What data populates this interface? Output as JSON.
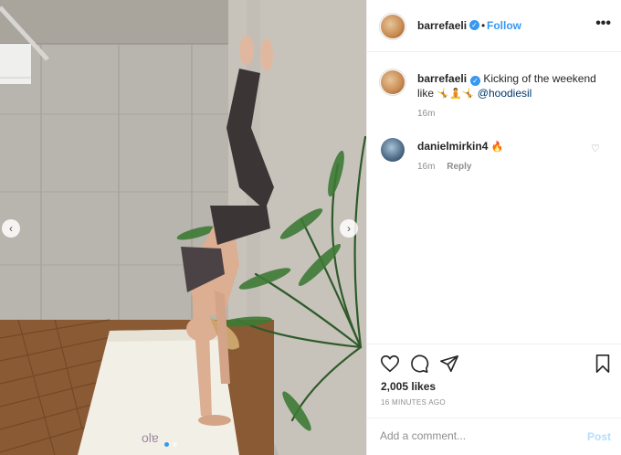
{
  "post": {
    "username": "barrefaeli",
    "verified_icon": "verified-badge-icon",
    "separator": "•",
    "follow_label": "Follow",
    "more_label": "•••"
  },
  "caption": {
    "username": "barrefaeli",
    "text_part1": "Kicking of the weekend",
    "text_part2": "like",
    "emojis": "🤸🧘🤸",
    "mention": "@hoodiesil",
    "time": "16m"
  },
  "comments": [
    {
      "username": "danielmirkin4",
      "text": "🔥",
      "time": "16m",
      "reply_label": "Reply"
    }
  ],
  "actions": {
    "likes": "2,005 likes",
    "time_ago": "16 MINUTES AGO"
  },
  "add_comment": {
    "placeholder": "Add a comment...",
    "post_label": "Post"
  },
  "colors": {
    "accent": "#3897f0",
    "post_disabled": "#b2dffc",
    "border": "#efefef",
    "muted": "#8e8e8e"
  }
}
